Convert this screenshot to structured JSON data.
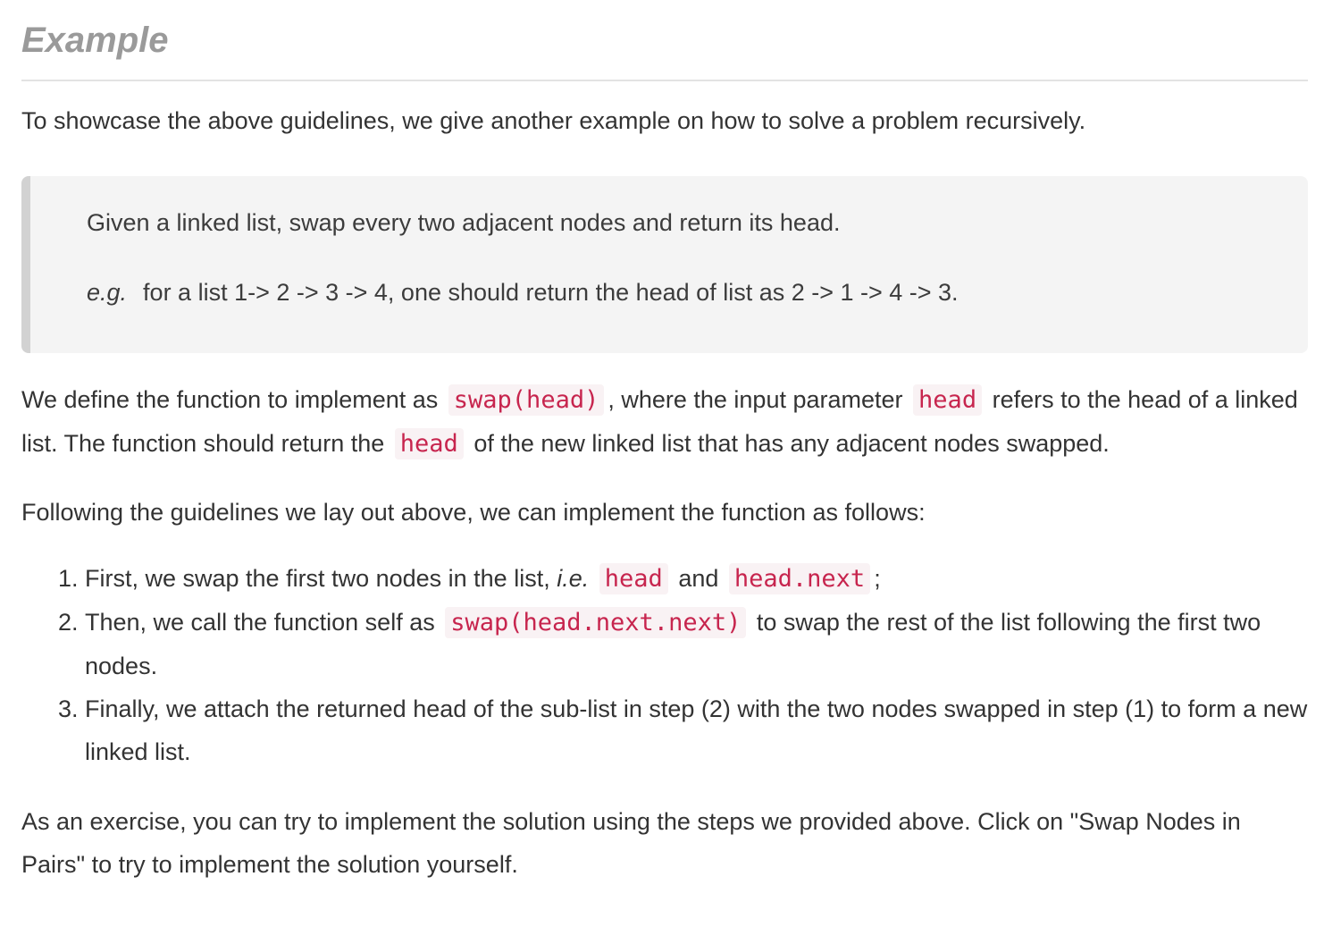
{
  "heading": "Example",
  "intro": "To showcase the above guidelines, we give another example on how to solve a problem recursively.",
  "problem": {
    "statement": "Given a linked list, swap every two adjacent nodes and return its head.",
    "example_prefix": "e.g.",
    "example_text": "for a list 1-> 2 -> 3 -> 4, one should return the head of list as 2 -> 1 -> 4 -> 3."
  },
  "definition": {
    "t1": "We define the function to implement as",
    "code1": "swap(head)",
    "t2": ", where the input parameter",
    "code2": "head",
    "t3": "refers to the head of a linked list. The function should return the",
    "code3": "head",
    "t4": "of the new linked list that has any adjacent nodes swapped."
  },
  "following": "Following the guidelines we lay out above, we can implement the function as follows:",
  "steps": {
    "s1": {
      "t1": "First, we swap the first two nodes in the list,",
      "ie": "i.e.",
      "code1": "head",
      "t2": "and",
      "code2": "head.next",
      "t3": ";"
    },
    "s2": {
      "t1": "Then, we call the function self as",
      "code1": "swap(head.next.next)",
      "t2": "to swap the rest of the list following the first two nodes."
    },
    "s3": {
      "t1": "Finally, we attach the returned head of the sub-list in step (2) with the two nodes swapped in step (1) to form a new linked list."
    }
  },
  "exercise": "As an exercise, you can try to implement the solution using the steps we provided above. Click on \"Swap Nodes in Pairs\" to try to implement the solution yourself."
}
